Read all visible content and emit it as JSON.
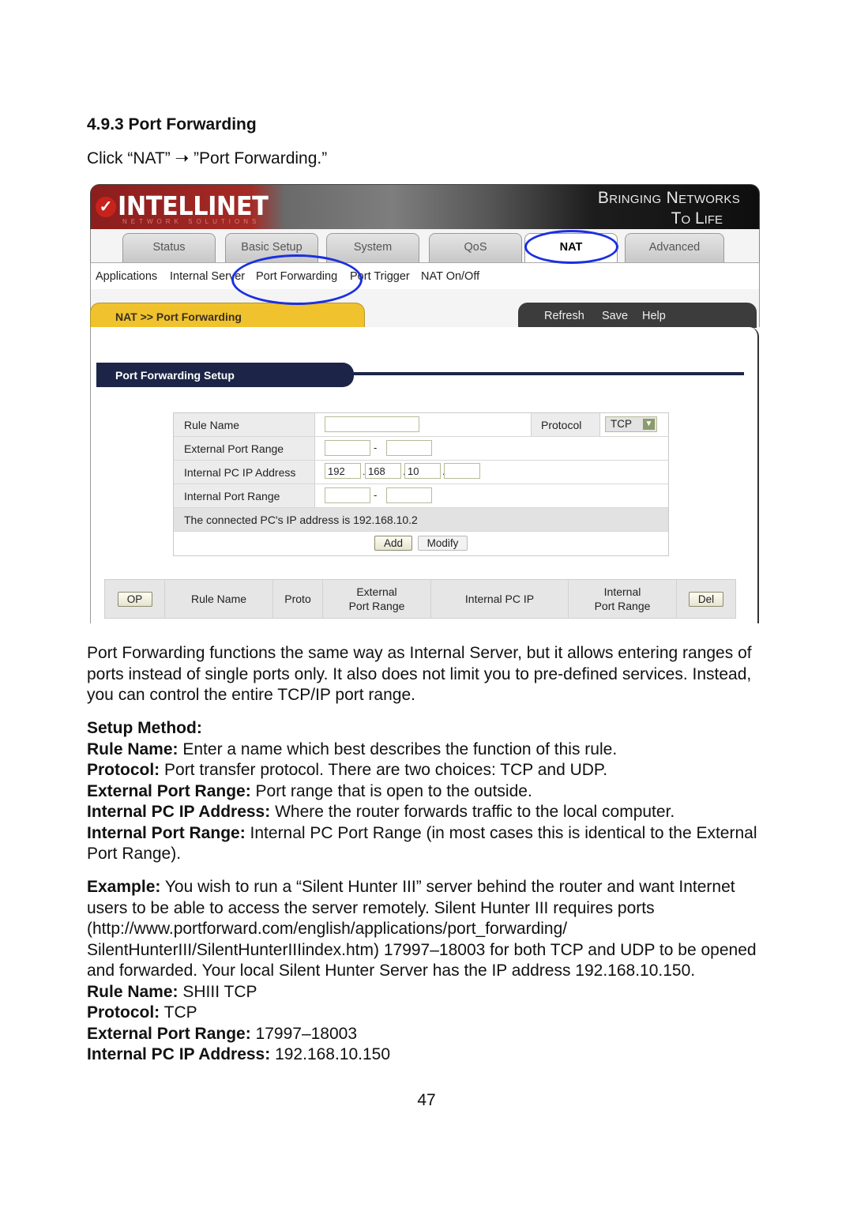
{
  "section_heading": "4.9.3 Port Forwarding",
  "click_instruction": "Click “NAT” ➝ ”Port Forwarding.”",
  "router_ui": {
    "brand": {
      "logo_mark": "✓",
      "logo_text": "INTELLINET",
      "logo_subtext": "NETWORK SOLUTIONS",
      "tagline_line1": "Bringing Networks",
      "tagline_line2": "To Life"
    },
    "main_tabs": [
      {
        "label": "Status",
        "active": false
      },
      {
        "label": "Basic Setup",
        "active": false
      },
      {
        "label": "System",
        "active": false
      },
      {
        "label": "QoS",
        "active": false
      },
      {
        "label": "NAT",
        "active": true
      },
      {
        "label": "Advanced",
        "active": false
      }
    ],
    "sub_tabs": [
      {
        "label": "Applications"
      },
      {
        "label": "Internal Server"
      },
      {
        "label": "Port Forwarding",
        "active": true
      },
      {
        "label": "Port Trigger"
      },
      {
        "label": "NAT On/Off"
      }
    ],
    "breadcrumb": "NAT >> Port Forwarding",
    "actions": {
      "refresh": "Refresh",
      "save": "Save",
      "help": "Help"
    },
    "setup_title": "Port Forwarding Setup",
    "form": {
      "rule_name_label": "Rule Name",
      "rule_name_value": "",
      "protocol_label": "Protocol",
      "protocol_value": "TCP",
      "external_port_range_label": "External Port Range",
      "external_port_from": "",
      "external_port_to": "",
      "range_separator": "-",
      "internal_ip_label": "Internal PC IP Address",
      "ip_octets": [
        "192",
        "168",
        "10",
        ""
      ],
      "ip_separator": ".",
      "internal_port_range_label": "Internal Port Range",
      "internal_port_from": "",
      "internal_port_to": "",
      "connected_ip_text": "The connected PC's IP address is 192.168.10.2",
      "add_button": "Add",
      "modify_button": "Modify"
    },
    "rules_table": {
      "op_button": "OP",
      "columns": [
        "Rule Name",
        "Proto",
        "External\nPort Range",
        "Internal PC IP",
        "Internal\nPort Range"
      ],
      "del_button": "Del"
    },
    "annotation_color": "#1b2fe0"
  },
  "body": {
    "intro": "Port Forwarding functions the same way as Internal Server, but it allows entering ranges of ports instead of single ports only. It also does not limit you to pre-defined services. Instead, you can control the entire TCP/IP port range.",
    "setup_heading": "Setup Method:",
    "definitions": [
      {
        "term": "Rule Name:",
        "text": " Enter a name which best describes the function of this rule."
      },
      {
        "term": "Protocol:",
        "text": " Port transfer protocol. There are two choices: TCP and UDP."
      },
      {
        "term": "External Port Range:",
        "text": " Port range that is open to the outside."
      },
      {
        "term": "Internal PC IP Address:",
        "text": " Where the router forwards traffic to the local computer."
      },
      {
        "term": "Internal Port Range:",
        "text": " Internal PC Port Range (in most cases this is identical to the External Port Range)."
      }
    ],
    "example_term": "Example:",
    "example_text": " You wish to run a “Silent Hunter III” server behind the router and want Internet users to be able to access the server remotely. Silent Hunter III requires ports (http://www.portforward.com/english/applications/port_forwarding/ SilentHunterIII/SilentHunterIIIindex.htm) 17997–18003 for both TCP and UDP to be opened and forwarded. Your local Silent Hunter Server has the IP address 192.168.10.150.",
    "example_values": [
      {
        "term": "Rule Name:",
        "text": " SHIII TCP"
      },
      {
        "term": "Protocol:",
        "text": " TCP"
      },
      {
        "term": "External Port Range:",
        "text": " 17997–18003"
      },
      {
        "term": "Internal PC IP Address:",
        "text": " 192.168.10.150"
      }
    ]
  },
  "page_number": "47"
}
